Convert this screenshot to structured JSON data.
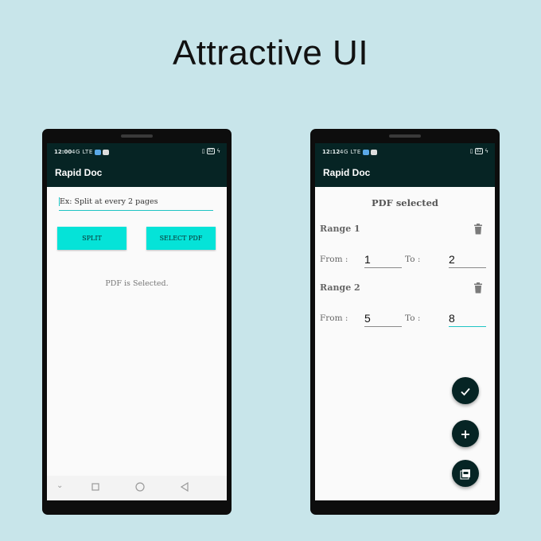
{
  "headline": "Attractive UI",
  "left_phone": {
    "status_time": "12:00",
    "status_signal": "4G LTE",
    "battery": "82",
    "app_title": "Rapid Doc",
    "split_input": {
      "placeholder": "Ex: Split at every 2 pages",
      "value": ""
    },
    "split_button": "SPLIT",
    "select_pdf_button": "SELECT PDF",
    "status_message": "PDF is Selected.",
    "nav_icons": [
      "chevron-down-icon",
      "square-icon",
      "circle-icon",
      "back-triangle-icon"
    ]
  },
  "right_phone": {
    "status_time": "12:12",
    "status_signal": "4G LTE",
    "battery": "82",
    "app_title": "Rapid Doc",
    "pdf_selected": "PDF selected",
    "from_label": "From :",
    "to_label": "To :",
    "ranges": [
      {
        "title": "Range 1",
        "from": "1",
        "to": "2"
      },
      {
        "title": "Range 2",
        "from": "5",
        "to": "8"
      }
    ],
    "fabs": [
      "check-icon",
      "plus-icon",
      "pdf-icon"
    ]
  },
  "colors": {
    "background": "#c8e5ea",
    "appbar": "#062424",
    "accent": "#05e3d8",
    "underline_active": "#1fc4c4"
  }
}
